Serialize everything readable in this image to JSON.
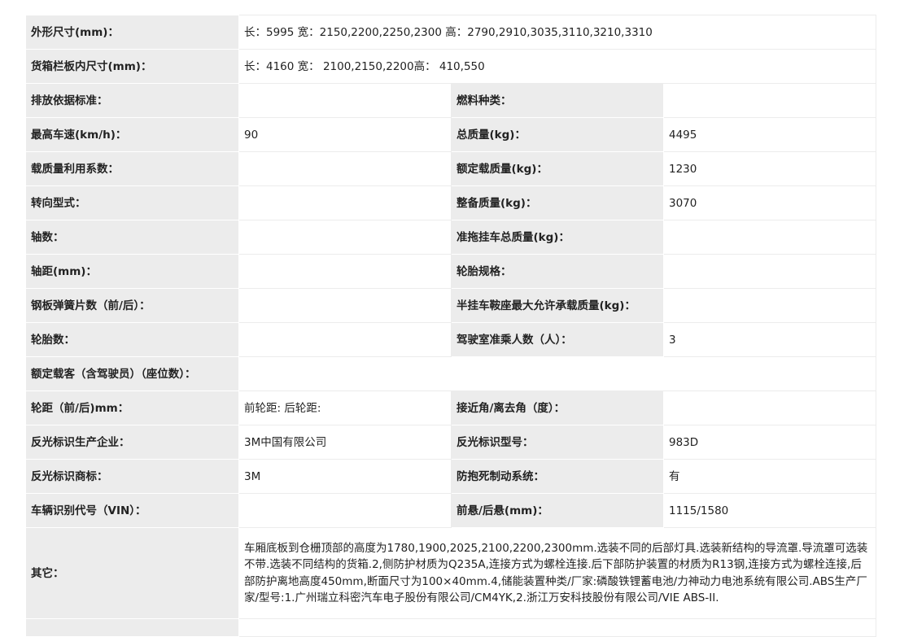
{
  "rows": [
    {
      "l1": "外形尺寸(mm)：",
      "v1": "长：5995 宽：2150,2200,2250,2300 高：2790,2910,3035,3110,3210,3310"
    },
    {
      "l1": "货箱栏板内尺寸(mm)：",
      "v1": "长：4160 宽： 2100,2150,2200高： 410,550"
    },
    {
      "l1": "排放依据标准：",
      "v1": "",
      "l2": "燃料种类：",
      "v2": ""
    },
    {
      "l1": "最高车速(km/h)：",
      "v1": "90",
      "l2": "总质量(kg)：",
      "v2": "4495"
    },
    {
      "l1": "载质量利用系数：",
      "v1": "",
      "l2": "额定载质量(kg)：",
      "v2": "1230"
    },
    {
      "l1": "转向型式：",
      "v1": "",
      "l2": "整备质量(kg)：",
      "v2": "3070"
    },
    {
      "l1": "轴数：",
      "v1": "",
      "l2": "准拖挂车总质量(kg)：",
      "v2": ""
    },
    {
      "l1": "轴距(mm)：",
      "v1": "",
      "l2": "轮胎规格：",
      "v2": ""
    },
    {
      "l1": "钢板弹簧片数（前/后）：",
      "v1": "",
      "l2": "半挂车鞍座最大允许承载质量(kg)：",
      "v2": ""
    },
    {
      "l1": "轮胎数：",
      "v1": "",
      "l2": "驾驶室准乘人数（人）：",
      "v2": "3"
    },
    {
      "l1": "额定载客（含驾驶员）（座位数）：",
      "v1": ""
    },
    {
      "l1": "轮距（前/后)mm：",
      "v1": "前轮距: 后轮距:",
      "l2": "接近角/离去角（度）：",
      "v2": ""
    },
    {
      "l1": "反光标识生产企业：",
      "v1": "3M中国有限公司",
      "l2": "反光标识型号：",
      "v2": "983D"
    },
    {
      "l1": "反光标识商标：",
      "v1": "3M",
      "l2": "防抱死制动系统：",
      "v2": "有"
    },
    {
      "l1": "车辆识别代号（VIN）：",
      "v1": "",
      "l2": "前悬/后悬(mm)：",
      "v2": "1115/1580"
    },
    {
      "l1": "其它：",
      "v1": "车厢底板到仓栅顶部的高度为1780,1900,2025,2100,2200,2300mm.选装不同的后部灯具.选装新结构的导流罩.导流罩可选装不带.选装不同结构的货箱.2,侧防护材质为Q235A,连接方式为螺栓连接.后下部防护装置的材质为R13钢,连接方式为螺栓连接,后部防护离地高度450mm,断面尺寸为100×40mm.4,储能装置种类/厂家:磷酸铁锂蓄电池/力神动力电池系统有限公司.ABS生产厂家/型号:1.广州瑞立科密汽车电子股份有限公司/CM4YK,2.浙江万安科技股份有限公司/VIE ABS-II."
    }
  ]
}
